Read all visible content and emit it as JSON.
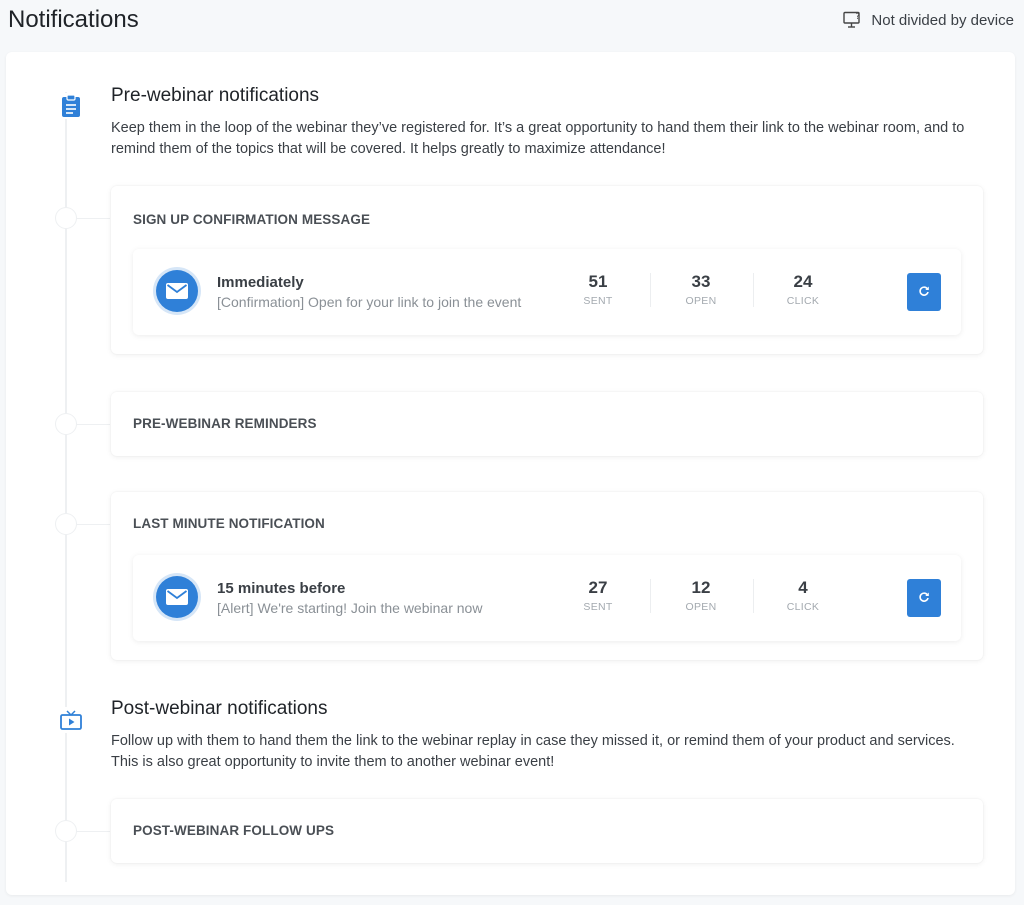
{
  "header": {
    "title": "Notifications",
    "device_note": "Not divided by device"
  },
  "sections": [
    {
      "title": "Pre-webinar notifications",
      "description": "Keep them in the loop of the webinar they’ve registered for. It’s a great opportunity to hand them their link to the webinar room, and to remind them of the topics that will be covered. It helps greatly to maximize attendance!",
      "icon": "clipboard-icon",
      "cards": [
        {
          "title": "SIGN UP CONFIRMATION MESSAGE",
          "message": {
            "timing": "Immediately",
            "subject": "[Confirmation] Open for your link to join the event",
            "stats": [
              {
                "value": "51",
                "label": "SENT"
              },
              {
                "value": "33",
                "label": "OPEN"
              },
              {
                "value": "24",
                "label": "CLICK"
              }
            ]
          }
        },
        {
          "title": "PRE-WEBINAR REMINDERS"
        },
        {
          "title": "LAST MINUTE NOTIFICATION",
          "message": {
            "timing": "15 minutes before",
            "subject": "[Alert] We're starting! Join the webinar now",
            "stats": [
              {
                "value": "27",
                "label": "SENT"
              },
              {
                "value": "12",
                "label": "OPEN"
              },
              {
                "value": "4",
                "label": "CLICK"
              }
            ]
          }
        }
      ]
    },
    {
      "title": "Post-webinar notifications",
      "description": "Follow up with them to hand them the link to the webinar replay in case they missed it, or remind them of your product and services. This is also great opportunity to invite them to another webinar event!",
      "icon": "tv-play-icon",
      "cards": [
        {
          "title": "POST-WEBINAR FOLLOW UPS"
        }
      ]
    }
  ],
  "colors": {
    "accent": "#2f80d8",
    "background": "#f6f8fa",
    "card": "#ffffff"
  }
}
